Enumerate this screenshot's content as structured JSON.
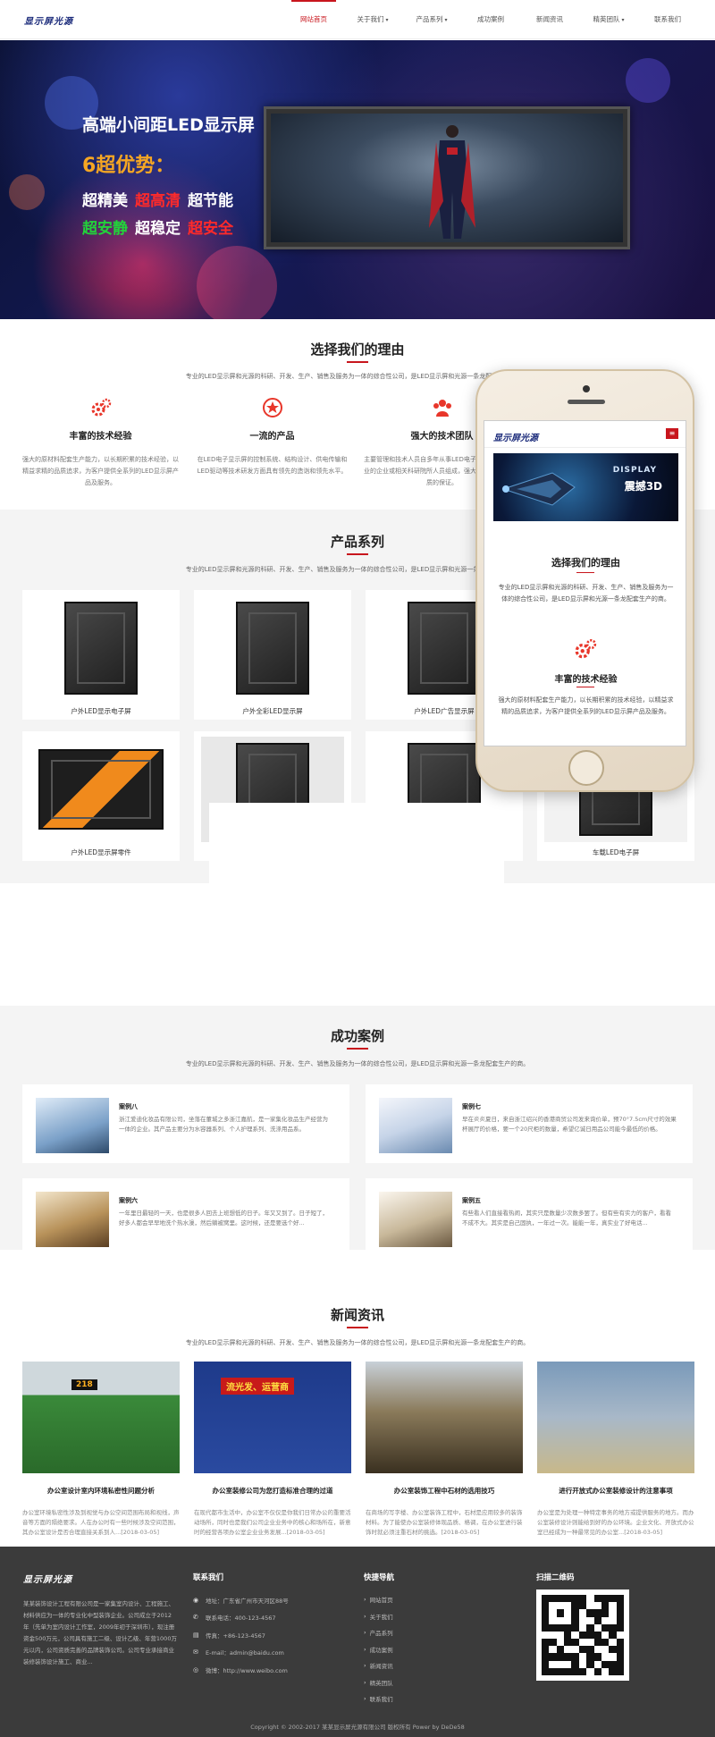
{
  "header": {
    "logo": "显示屏光源",
    "nav": [
      {
        "label": "网站首页",
        "active": true,
        "dropdown": false
      },
      {
        "label": "关于我们",
        "active": false,
        "dropdown": true
      },
      {
        "label": "产品系列",
        "active": false,
        "dropdown": true
      },
      {
        "label": "成功案例",
        "active": false,
        "dropdown": false
      },
      {
        "label": "新闻资讯",
        "active": false,
        "dropdown": false
      },
      {
        "label": "精英团队",
        "active": false,
        "dropdown": true
      },
      {
        "label": "联系我们",
        "active": false,
        "dropdown": false
      }
    ]
  },
  "banner": {
    "title": "高端小间距LED显示屏",
    "sub": "6超优势：",
    "line1": [
      "超精美",
      "超高清",
      "超节能"
    ],
    "line2": [
      "超安静",
      "超稳定",
      "超安全"
    ]
  },
  "why": {
    "title": "选择我们的理由",
    "desc": "专业的LED显示屏和光源的科研、开发、生产、销售及服务为一体的综合性公司，是LED显示屏和光源一条龙配套生产的商。",
    "items": [
      {
        "icon": "gear-icon",
        "title": "丰富的技术经验",
        "text": "强大的原材料配套生产能力，以长期积累的技术经验，以精益求精的品质追求，为客户提供全系列的LED显示屏产品及服务。"
      },
      {
        "icon": "star-icon",
        "title": "一流的产品",
        "text": "在LED电子显示屏的控制系统、结构设计、供电传输和LED驱动等技术研发方面具有领先的造诣和领先水平。"
      },
      {
        "icon": "team-icon",
        "title": "强大的技术团队",
        "text": "主要管理和技术人员自多年从事LED电子显示屏和光源产业的企业或相关科研院所人员组成，强大的团队实力是品质的保证。"
      }
    ]
  },
  "products": {
    "title": "产品系列",
    "desc": "专业的LED显示屏和光源的科研、开发、生产、销售及服务为一体的综合性公司，是LED显示屏和光源一条龙配套生产的商。",
    "items": [
      {
        "label": "户外LED显示电子屏"
      },
      {
        "label": "户外全彩LED显示屏"
      },
      {
        "label": "户外LED广告显示屏"
      },
      {
        "label": ""
      },
      {
        "label": "户外LED显示屏零件"
      },
      {
        "label": ""
      },
      {
        "label": ""
      },
      {
        "label": "车载LED电子屏"
      }
    ]
  },
  "phone": {
    "logo": "显示屏光源",
    "menu": "≡",
    "banner_t1": "DISPLAY",
    "banner_t2": "震撼3D",
    "title": "选择我们的理由",
    "text": "专业的LED显示屏和光源的科研、开发、生产、销售及服务为一体的综合性公司，是LED显示屏和光源一条龙配套生产的商。",
    "item_title": "丰富的技术经验",
    "item_text": "强大的原材料配套生产能力，以长期积累的技术经验，以精益求精的品质追求，为客户提供全系列的LED显示屏产品及服务。"
  },
  "cases": {
    "title": "成功案例",
    "desc": "专业的LED显示屏和光源的科研、开发、生产、销售及服务为一体的综合性公司，是LED显示屏和光源一条龙配套生产的商。",
    "items": [
      {
        "title": "案例八",
        "text": "浙江爱迪化妆品有限公司，坐落在董城之多浙江嘉航，是一家集化妆品生产经营为一体的企业。其产品主要分为水容器系列、个人护理系列、洗涤用品系。"
      },
      {
        "title": "案例七",
        "text": "早在炎炎夏日，来自浙江绍兴的香港商贸公司发来询价单，预70°7.5cm尺寸的效果杯展厅的价格，要一个20尺柜的数量，希望亿诚日用品公司能今最低的价格。"
      },
      {
        "title": "案例六",
        "text": "一年里日最轻的一天，也是很多人回去上班想低的日子。年又又到了。日子短了，好多人都会早早地洗个热水澡，然后躺被窝里。这时候，还是要选个好..."
      },
      {
        "title": "案例五",
        "text": "有些看人们直接看热闹，其实只是数量少次数多罢了。但有些有实力的客户，看看不成不大。其实是自己固执，一年过一次。能能一年，真实业了好电话..."
      }
    ]
  },
  "news": {
    "title": "新闻资讯",
    "desc": "专业的LED显示屏和光源的科研、开发、生产、销售及服务为一体的综合性公司，是LED显示屏和光源一条龙配套生产的商。",
    "items": [
      {
        "title": "办公室设计室内环境私密性问题分析",
        "text": "办公室环境私密性涉及到视觉与办公空间范围布局和视线，声音等方面的隔绝要求。人在办公时有一些时候涉及空间范围，其办公室设计是否合理直接关系到人...[2018-03-05]",
        "sign": "218"
      },
      {
        "title": "办公室装修公司为您打造标准合理的过道",
        "text": "在现代都市生活中，办公室不仅仅是你我们日常办公的重要活动场所，同时也是我们公司企业业务中的核心和场所在，新意时的经营各项办公室企业业务发展...[2018-03-05]",
        "sign": "流光发、运营商"
      },
      {
        "title": "办公室装饰工程中石材的选用技巧",
        "text": "在商场的写字楼、办公室装饰工程中，石材是应用较多的装饰材料。为了能使办公室装修体现品质、格调，在办公室进行装饰时就必须注重石材的挑选。[2018-03-05]",
        "sign": ""
      },
      {
        "title": "进行开放式办公室装修设计的注意事项",
        "text": "办公室是为处理一种特定事务的地方或提供服务的地方。而办公室装修设计则能给到好的办公环境。企业文化、开放式办公室已经成为一种最常见的办公室...[2018-03-05]",
        "sign": ""
      }
    ]
  },
  "footer": {
    "logo": "显示屏光源",
    "about": "某某装饰设计工程有限公司是一家集室内设计、工程施工、材料供应为一体的专业化中型装饰企业。公司成立于2012年（先单为室内设计工作室，2009年初于深圳市），现注册资金500万元，公司具有施工二级、设计乙级、年营1000万元以内，公司资质完善的品牌装饰公司。公司专业承接商业装修装饰设计施工、商业...",
    "contact_title": "联系我们",
    "contact": [
      {
        "icon": "location-icon",
        "text": "地址：广东省广州市天河区88号"
      },
      {
        "icon": "phone-icon",
        "text": "联系电话：400-123-4567"
      },
      {
        "icon": "fax-icon",
        "text": "传真：+86-123-4567"
      },
      {
        "icon": "email-icon",
        "text": "E-mail：admin@baidu.com"
      },
      {
        "icon": "weibo-icon",
        "text": "微博：http://www.weibo.com"
      }
    ],
    "links_title": "快捷导航",
    "links": [
      "网站首页",
      "关于我们",
      "产品系列",
      "成功案例",
      "新闻资讯",
      "精英团队",
      "联系我们"
    ],
    "qr_title": "扫描二维码",
    "copyright": "Copyright © 2002-2017 某某显示屏光源有限公司 版权所有 Power by DeDe58"
  },
  "colors": {
    "accent": "#c8161d",
    "footer_bg": "#3b3b3b",
    "gray_bg": "#f4f4f4"
  }
}
